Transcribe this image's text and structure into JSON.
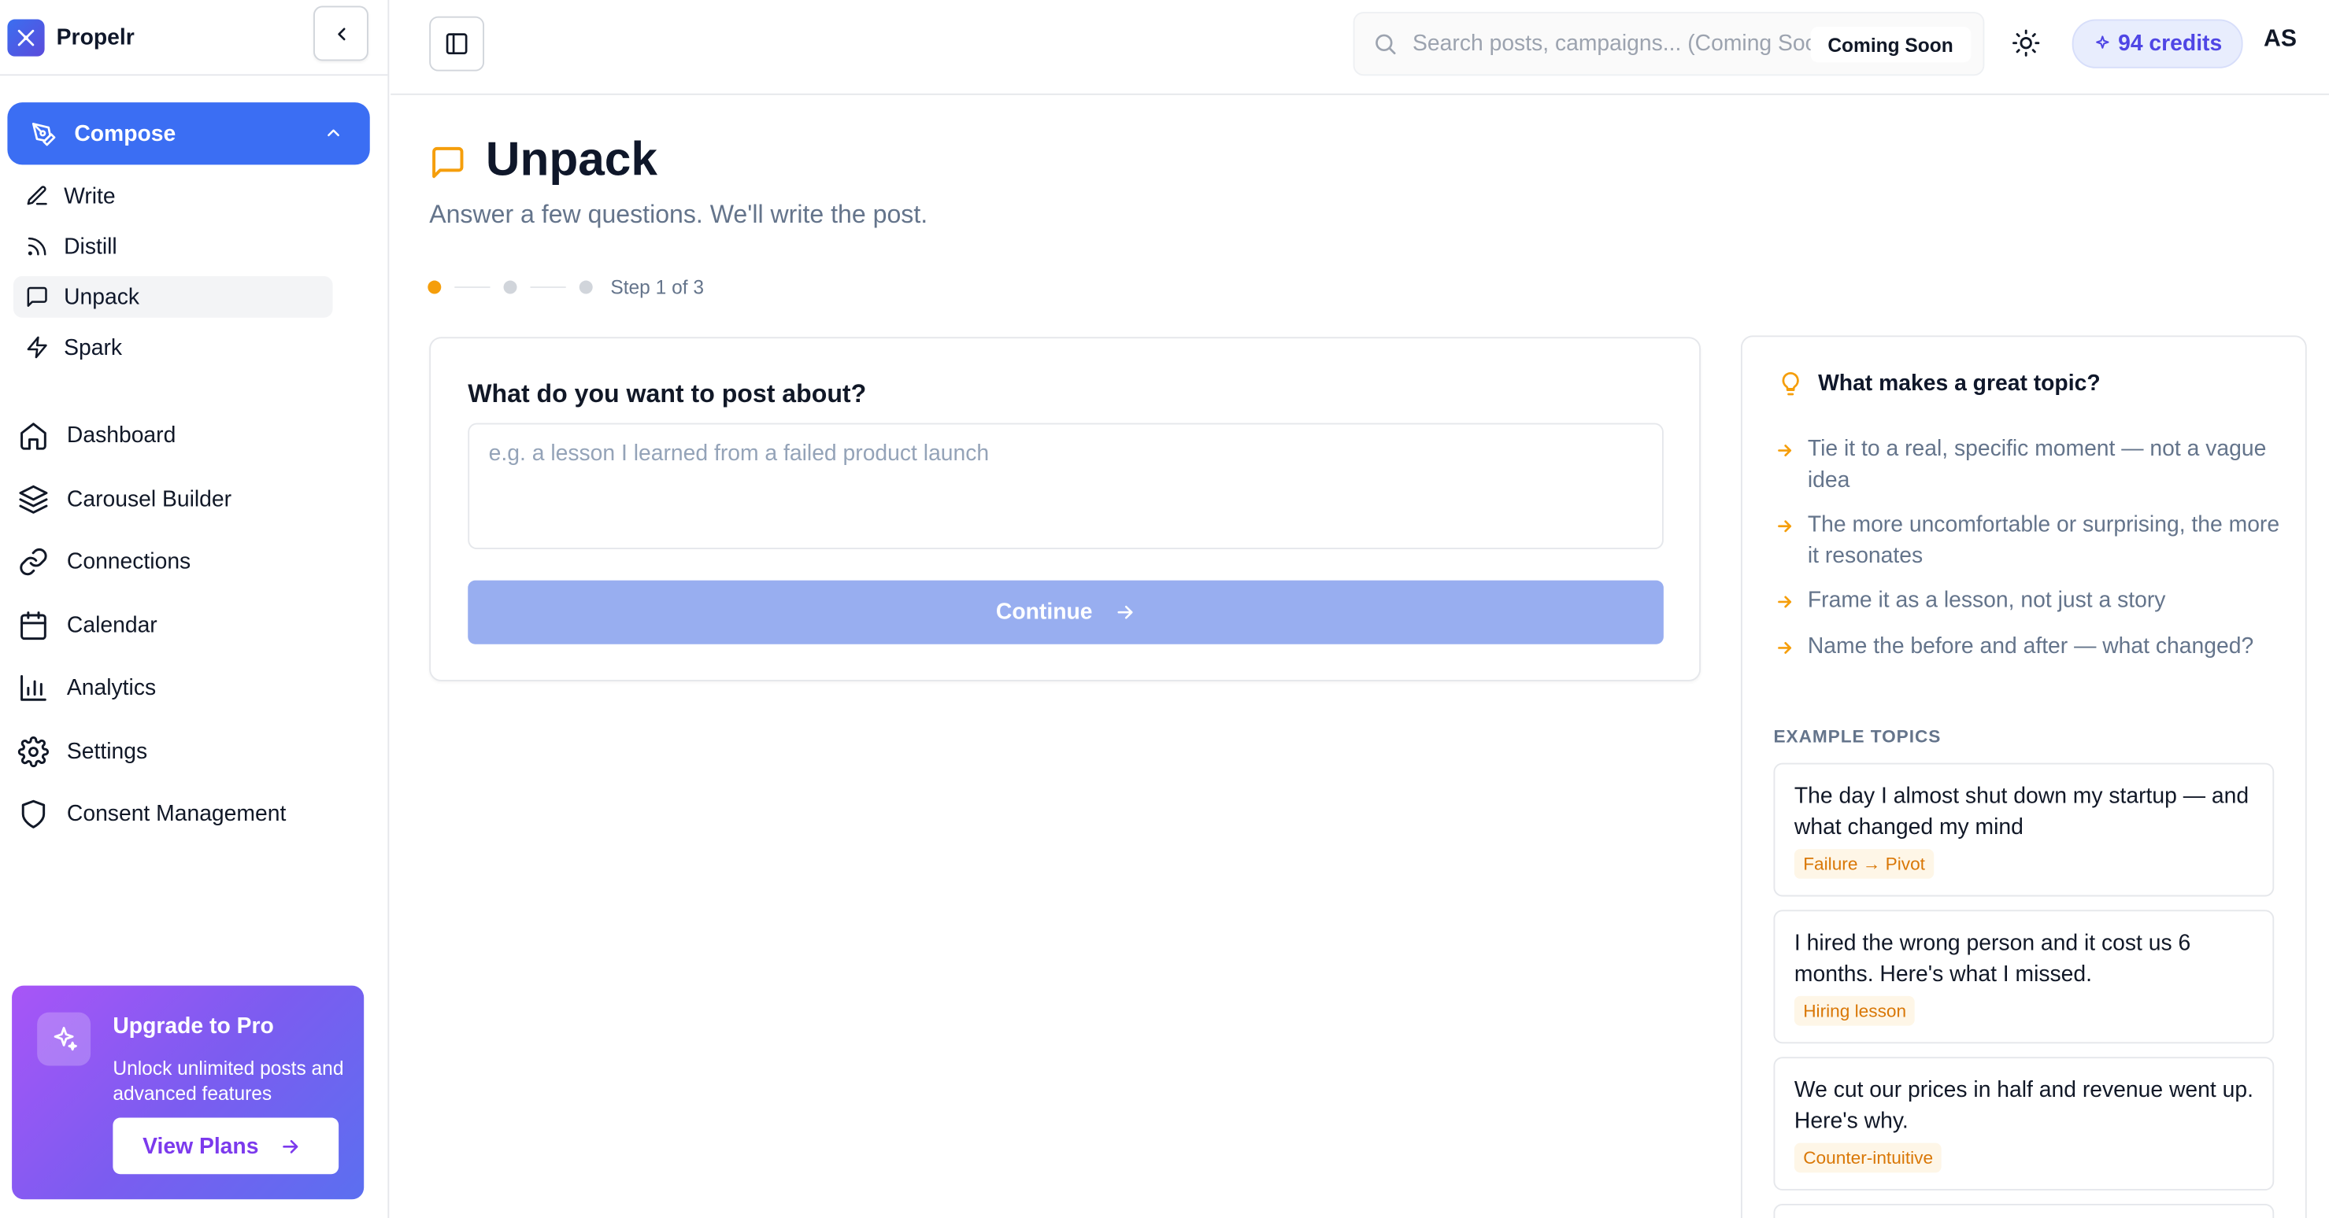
{
  "brand": {
    "name": "Propelr"
  },
  "sidebar": {
    "compose_label": "Compose",
    "compose_items": [
      {
        "label": "Write",
        "icon": "pencil-icon"
      },
      {
        "label": "Distill",
        "icon": "rss-icon"
      },
      {
        "label": "Unpack",
        "icon": "message-square-icon",
        "active": true
      },
      {
        "label": "Spark",
        "icon": "zap-icon"
      }
    ],
    "nav_items": [
      {
        "label": "Dashboard",
        "icon": "home-icon"
      },
      {
        "label": "Carousel Builder",
        "icon": "layers-icon"
      },
      {
        "label": "Connections",
        "icon": "link-icon"
      },
      {
        "label": "Calendar",
        "icon": "calendar-icon"
      },
      {
        "label": "Analytics",
        "icon": "bar-chart-icon"
      },
      {
        "label": "Settings",
        "icon": "gear-icon"
      },
      {
        "label": "Consent Management",
        "icon": "shield-icon"
      }
    ],
    "upgrade": {
      "title": "Upgrade to Pro",
      "description": "Unlock unlimited posts and advanced features",
      "button": "View Plans"
    }
  },
  "topbar": {
    "search_placeholder": "Search posts, campaigns... (Coming Soon)",
    "coming_soon": "Coming Soon",
    "credits": "94 credits",
    "avatar": "AS"
  },
  "main": {
    "title": "Unpack",
    "subtitle": "Answer a few questions. We'll write the post.",
    "step_text": "Step 1 of 3",
    "question": "What do you want to post about?",
    "textarea_placeholder": "e.g. a lesson I learned from a failed product launch",
    "continue_label": "Continue"
  },
  "tips": {
    "heading": "What makes a great topic?",
    "items": [
      "Tie it to a real, specific moment — not a vague idea",
      "The more uncomfortable or surprising, the more it resonates",
      "Frame it as a lesson, not just a story",
      "Name the before and after — what changed?"
    ],
    "examples_label": "EXAMPLE TOPICS",
    "examples": [
      {
        "text": "The day I almost shut down my startup — and what changed my mind",
        "tag": "Failure → Pivot"
      },
      {
        "text": "I hired the wrong person and it cost us 6 months. Here's what I missed.",
        "tag": "Hiring lesson"
      },
      {
        "text": "We cut our prices in half and revenue went up. Here's why.",
        "tag": "Counter-intuitive"
      }
    ]
  },
  "colors": {
    "accent": "#3b6ef3",
    "warning": "#f59e0b",
    "credits_text": "#4f46e5"
  }
}
